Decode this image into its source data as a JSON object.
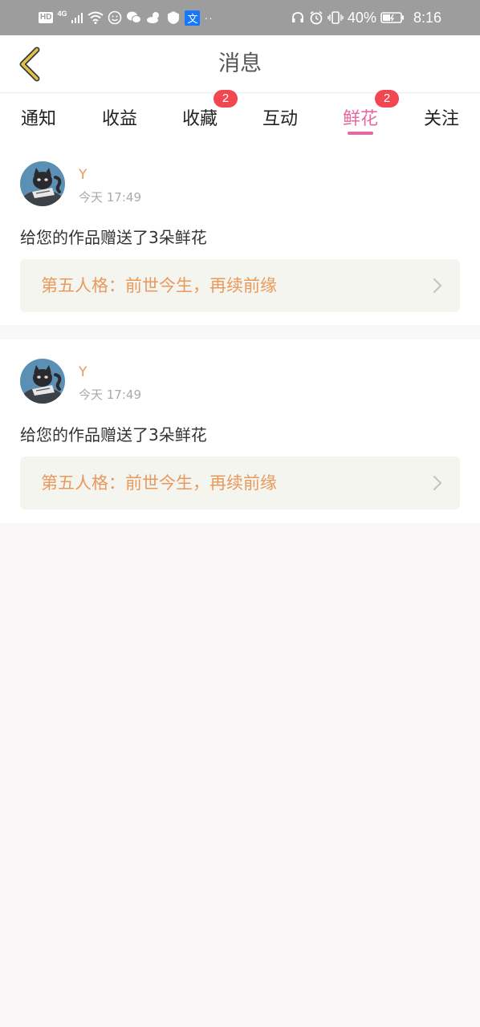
{
  "status_bar": {
    "hd": "HD",
    "network": "4G",
    "battery_pct": "40%",
    "time": "8:16",
    "app_badge": "文"
  },
  "header": {
    "title": "消息"
  },
  "tabs": [
    {
      "label": "通知"
    },
    {
      "label": "收益"
    },
    {
      "label": "收藏",
      "badge": "2"
    },
    {
      "label": "互动"
    },
    {
      "label": "鲜花",
      "badge": "2",
      "active": true
    },
    {
      "label": "关注"
    }
  ],
  "messages": [
    {
      "username": "Y",
      "time": "今天 17:49",
      "text": "给您的作品赠送了3朵鲜花",
      "work_title": "第五人格：前世今生，再续前缘"
    },
    {
      "username": "Y",
      "time": "今天 17:49",
      "text": "给您的作品赠送了3朵鲜花",
      "work_title": "第五人格：前世今生，再续前缘"
    }
  ],
  "colors": {
    "accent_pink": "#e668a0",
    "accent_orange": "#e8995e",
    "badge_red": "#f24650",
    "back_arrow": "#e2c34a"
  }
}
